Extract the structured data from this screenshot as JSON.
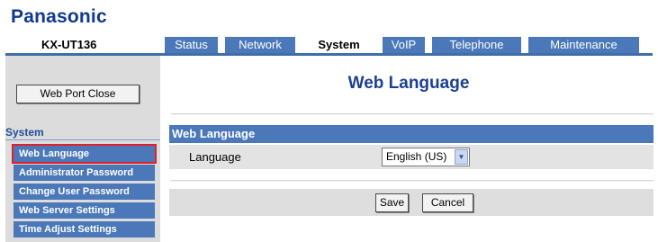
{
  "brand": {
    "logo_text": "Panasonic",
    "model": "KX-UT136"
  },
  "nav": {
    "tabs": [
      {
        "label": "Status",
        "active": false
      },
      {
        "label": "Network",
        "active": false
      },
      {
        "label": "System",
        "active": true
      },
      {
        "label": "VoIP",
        "active": false
      },
      {
        "label": "Telephone",
        "active": false
      },
      {
        "label": "Maintenance",
        "active": false
      }
    ]
  },
  "sidebar": {
    "port_close_label": "Web Port Close",
    "heading": "System",
    "items": [
      {
        "label": "Web Language",
        "selected": true
      },
      {
        "label": "Administrator Password",
        "selected": false
      },
      {
        "label": "Change User Password",
        "selected": false
      },
      {
        "label": "Web Server Settings",
        "selected": false
      },
      {
        "label": "Time Adjust Settings",
        "selected": false
      }
    ]
  },
  "main": {
    "title": "Web Language",
    "section_title": "Web Language",
    "language": {
      "label": "Language",
      "value": "English (US)"
    },
    "buttons": {
      "save": "Save",
      "cancel": "Cancel"
    }
  },
  "colors": {
    "brand_blue": "#0f3a8f",
    "nav_blue": "#4a78b8",
    "title_blue": "#1c3f94",
    "selection_red": "#e3202a"
  }
}
